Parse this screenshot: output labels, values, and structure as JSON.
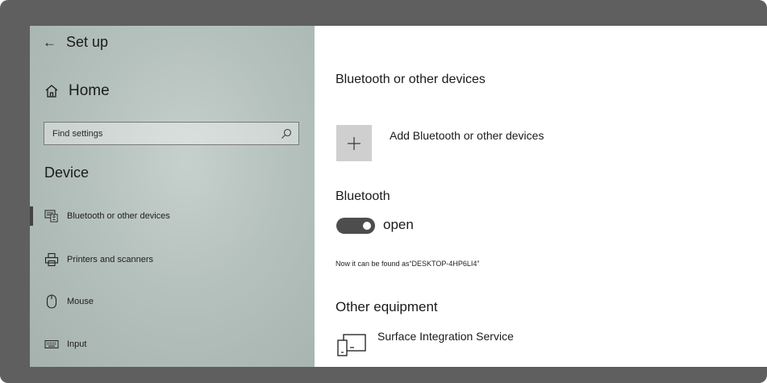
{
  "sidebar": {
    "back_label": "Set up",
    "home_label": "Home",
    "search": {
      "placeholder": "Find settings"
    },
    "section_title": "Device",
    "items": [
      {
        "label": "Bluetooth or other devices",
        "icon": "bluetooth-device-icon",
        "selected": true
      },
      {
        "label": "Printers and scanners",
        "icon": "printer-icon",
        "selected": false
      },
      {
        "label": "Mouse",
        "icon": "mouse-icon",
        "selected": false
      },
      {
        "label": "Input",
        "icon": "keyboard-icon",
        "selected": false
      }
    ]
  },
  "main": {
    "devices_heading": "Bluetooth or other devices",
    "add_label": "Add Bluetooth or other devices",
    "bluetooth_heading": "Bluetooth",
    "bluetooth_toggle": {
      "state_label": "open",
      "on": true
    },
    "discoverable_text": "Now it can be found as“DESKTOP-4HP6LI4”",
    "other_heading": "Other equipment",
    "other_devices": [
      {
        "name": "Surface Integration Service",
        "icon": "device-icon"
      }
    ]
  },
  "colors": {
    "frame": "#5f5f5f",
    "sidebar": "#b5c1bd",
    "toggle_on": "#4d4d4d",
    "add_tile": "#cfcfcf"
  }
}
